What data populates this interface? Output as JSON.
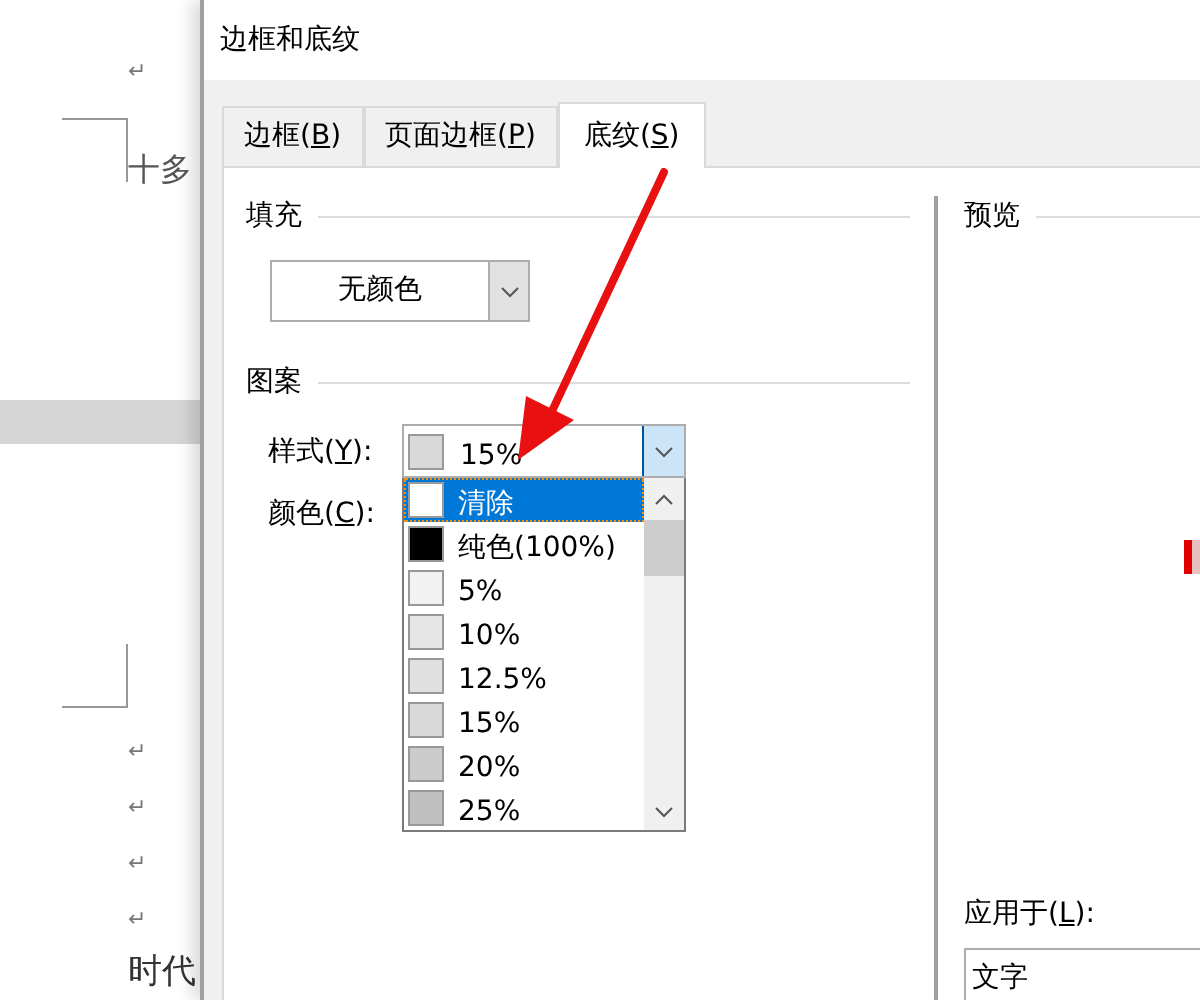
{
  "document": {
    "marks_top": [
      "↵"
    ],
    "text_top": "十多",
    "marks_bottom": [
      "↵",
      "↵",
      "↵",
      "↵"
    ],
    "text_bottom": "时代"
  },
  "window": {
    "title": "边框和底纹"
  },
  "tabs": [
    {
      "label": "边框(B)",
      "selected": false
    },
    {
      "label": "页面边框(P)",
      "selected": false
    },
    {
      "label": "底纹(S)",
      "selected": true
    }
  ],
  "fill": {
    "heading": "填充",
    "value": "无颜色"
  },
  "pattern": {
    "heading": "图案",
    "style_label": "样式(Y):",
    "style_value": "15%",
    "color": "#d9d9d9",
    "color_label": "颜色(C):",
    "options": [
      {
        "label": "清除",
        "color": "#ffffff",
        "selected": true
      },
      {
        "label": "纯色(100%)",
        "color": "#000000",
        "selected": false
      },
      {
        "label": "5%",
        "color": "#f2f2f2",
        "selected": false
      },
      {
        "label": "10%",
        "color": "#e6e6e6",
        "selected": false
      },
      {
        "label": "12.5%",
        "color": "#e0e0e0",
        "selected": false
      },
      {
        "label": "15%",
        "color": "#d9d9d9",
        "selected": false
      },
      {
        "label": "20%",
        "color": "#cccccc",
        "selected": false
      },
      {
        "label": "25%",
        "color": "#bfbfbf",
        "selected": false
      }
    ]
  },
  "preview": {
    "heading": "预览",
    "apply_label": "应用于(L):",
    "apply_value": "文字"
  }
}
